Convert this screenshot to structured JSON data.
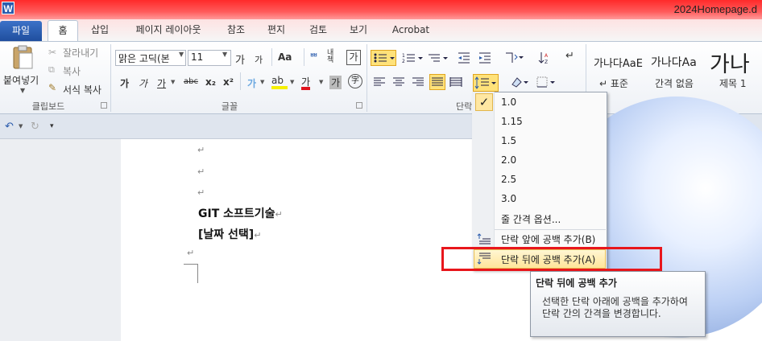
{
  "window": {
    "title": "2024Homepage.d",
    "app_icon": "W"
  },
  "tabs": [
    {
      "label": "파일"
    },
    {
      "label": "홈"
    },
    {
      "label": "삽입"
    },
    {
      "label": "페이지 레이아웃"
    },
    {
      "label": "참조"
    },
    {
      "label": "편지"
    },
    {
      "label": "검토"
    },
    {
      "label": "보기"
    },
    {
      "label": "Acrobat"
    }
  ],
  "clipboard": {
    "paste": "붙여넣기",
    "cut": "잘라내기",
    "copy": "복사",
    "format_painter": "서식 복사",
    "group": "클립보드"
  },
  "font": {
    "name": "맑은 고딕(본",
    "size": "11",
    "group": "글꼴",
    "grow": "가",
    "shrink": "가",
    "case": "Aa",
    "phonetic": "가",
    "bold": "가",
    "italic": "가",
    "underline": "가",
    "strike": "abc",
    "sub": "x₂",
    "sup": "x²",
    "highlight": "가",
    "color": "가",
    "shade": "가"
  },
  "paragraph": {
    "group_prefix": "단락"
  },
  "styles": [
    {
      "sample": "가나다AaE",
      "name": "↵ 표준"
    },
    {
      "sample": "가나다Aa",
      "name": "간격 없음"
    },
    {
      "sample": "가나",
      "name": "제목 1"
    }
  ],
  "document": {
    "line1": "GIT 소프트기술",
    "line2": "[날짜 선택]",
    "para_mark": "↵"
  },
  "line_spacing_menu": {
    "checked": "1.0",
    "options": [
      "1.0",
      "1.15",
      "1.5",
      "2.0",
      "2.5",
      "3.0"
    ],
    "options_label": "줄 간격 옵션...",
    "add_before": "단락 앞에 공백 추가(B)",
    "add_after": "단락 뒤에 공백 추가(A)"
  },
  "tooltip": {
    "title": "단락 뒤에 공백 추가",
    "body": "선택한 단락 아래에 공백을 추가하여 단락 간의 간격을 변경합니다."
  }
}
